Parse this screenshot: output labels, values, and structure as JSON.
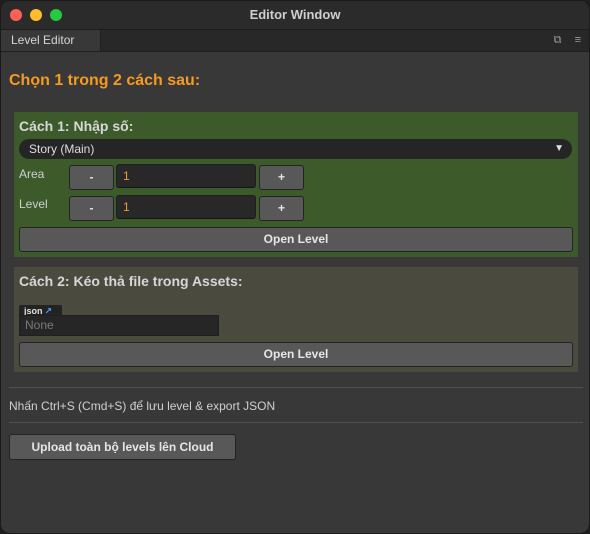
{
  "window": {
    "title": "Editor Window"
  },
  "tabbar": {
    "tab_label": "Level Editor",
    "icons": [
      "maximize-icon",
      "menu-icon"
    ]
  },
  "main": {
    "heading": "Chọn 1 trong 2 cách sau:",
    "method1": {
      "title": "Cách 1: Nhập số:",
      "dropdown_value": "Story (Main)",
      "area": {
        "label": "Area",
        "minus": "-",
        "value": "1",
        "plus": "+"
      },
      "level": {
        "label": "Level",
        "minus": "-",
        "value": "1",
        "plus": "+"
      },
      "open_button": "Open Level"
    },
    "method2": {
      "title": "Cách 2: Kéo thả file trong Assets:",
      "field_label": "json",
      "field_value": "None",
      "open_button": "Open Level"
    },
    "hint": "Nhấn Ctrl+S (Cmd+S) để lưu level & export JSON",
    "upload_button": "Upload toàn bộ levels lên Cloud"
  },
  "colors": {
    "accent_orange": "#f79a1e",
    "panel1_green": "#3d5a2b",
    "panel2_olive": "#4b4a3f",
    "background": "#383838"
  }
}
